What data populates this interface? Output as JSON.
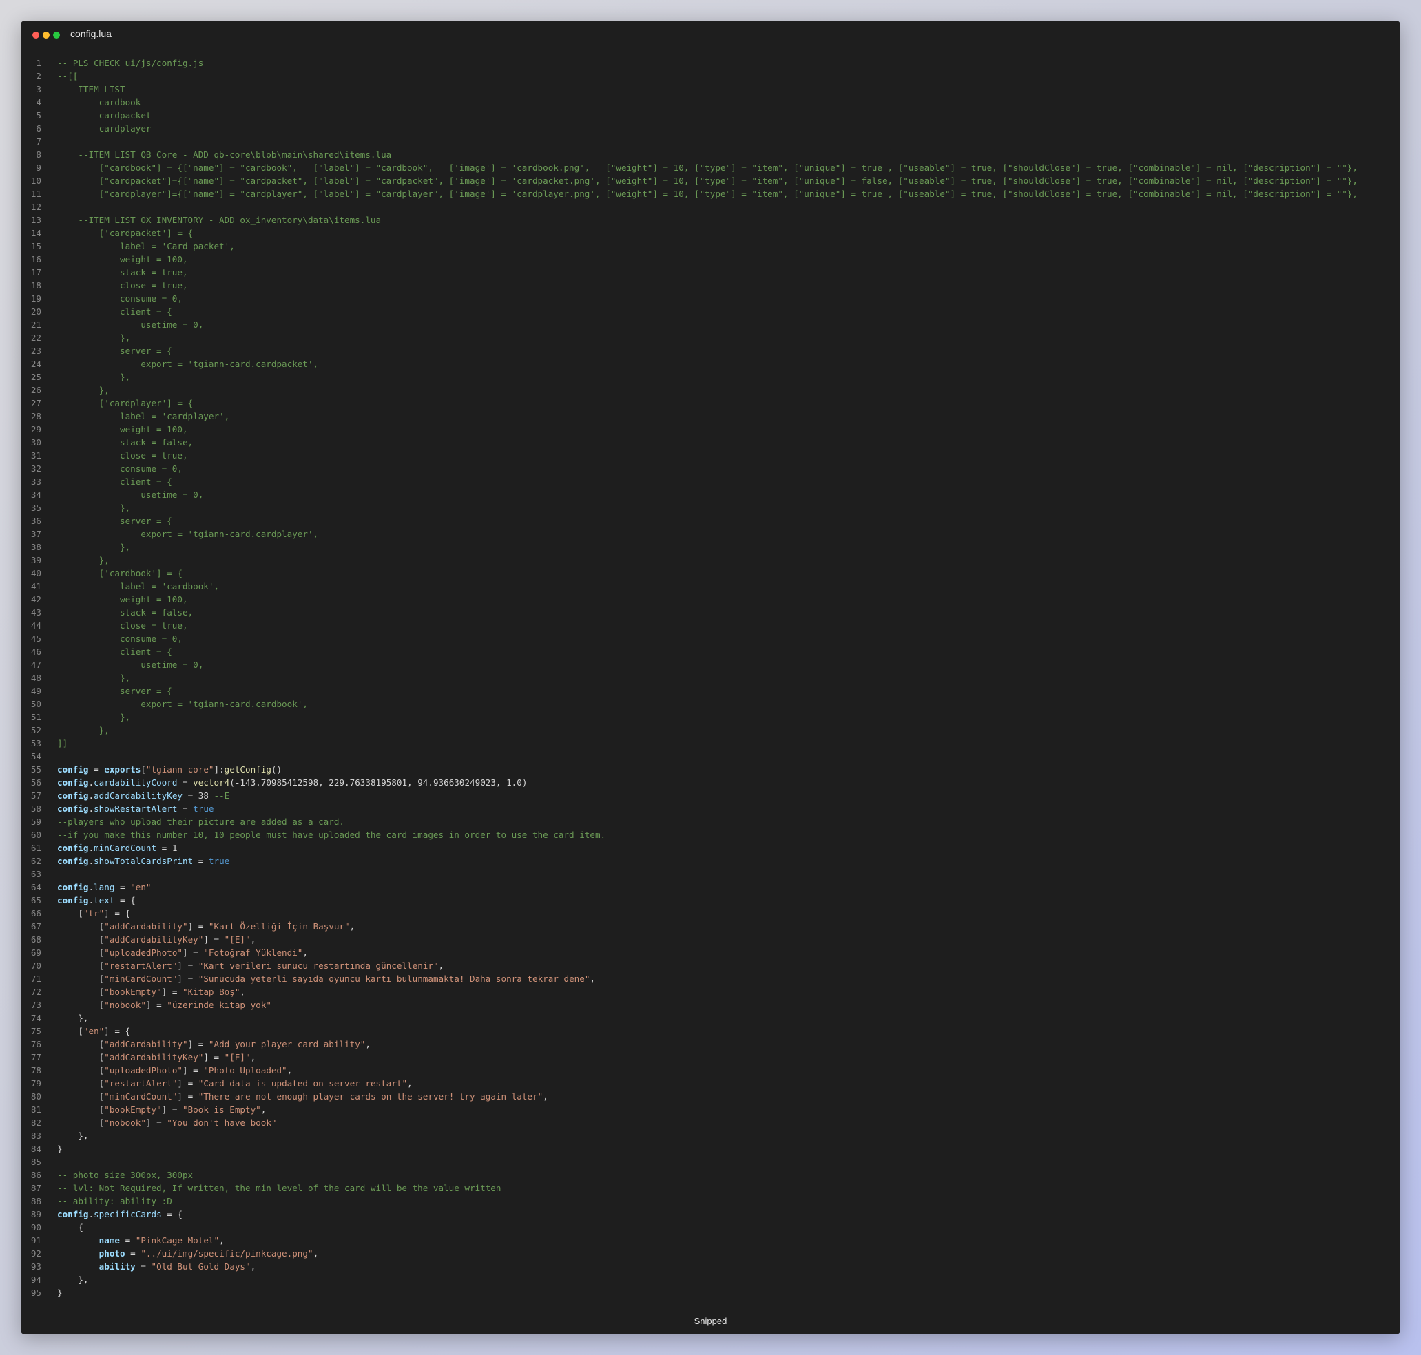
{
  "window": {
    "title": "config.lua",
    "footer": "Snipped"
  },
  "code": [
    {
      "n": "1",
      "t": [
        [
          "cm",
          "-- PLS CHECK ui/js/config.js"
        ]
      ]
    },
    {
      "n": "2",
      "t": [
        [
          "cm",
          "--[["
        ]
      ]
    },
    {
      "n": "3",
      "t": [
        [
          "cm",
          "    ITEM LIST"
        ]
      ]
    },
    {
      "n": "4",
      "t": [
        [
          "cm",
          "        cardbook"
        ]
      ]
    },
    {
      "n": "5",
      "t": [
        [
          "cm",
          "        cardpacket"
        ]
      ]
    },
    {
      "n": "6",
      "t": [
        [
          "cm",
          "        cardplayer"
        ]
      ]
    },
    {
      "n": "7",
      "t": []
    },
    {
      "n": "8",
      "t": [
        [
          "cm",
          "    --ITEM LIST QB Core - ADD qb-core\\blob\\main\\shared\\items.lua"
        ]
      ]
    },
    {
      "n": "9",
      "t": [
        [
          "cm",
          "        [\"cardbook\"] = {[\"name\"] = \"cardbook\",   [\"label\"] = \"cardbook\",   ['image'] = 'cardbook.png',   [\"weight\"] = 10, [\"type\"] = \"item\", [\"unique\"] = true , [\"useable\"] = true, [\"shouldClose\"] = true, [\"combinable\"] = nil, [\"description\"] = \"\"},"
        ]
      ]
    },
    {
      "n": "10",
      "t": [
        [
          "cm",
          "        [\"cardpacket\"]={[\"name\"] = \"cardpacket\", [\"label\"] = \"cardpacket\", ['image'] = 'cardpacket.png', [\"weight\"] = 10, [\"type\"] = \"item\", [\"unique\"] = false, [\"useable\"] = true, [\"shouldClose\"] = true, [\"combinable\"] = nil, [\"description\"] = \"\"},"
        ]
      ]
    },
    {
      "n": "11",
      "t": [
        [
          "cm",
          "        [\"cardplayer\"]={[\"name\"] = \"cardplayer\", [\"label\"] = \"cardplayer\", ['image'] = 'cardplayer.png', [\"weight\"] = 10, [\"type\"] = \"item\", [\"unique\"] = true , [\"useable\"] = true, [\"shouldClose\"] = true, [\"combinable\"] = nil, [\"description\"] = \"\"},"
        ]
      ]
    },
    {
      "n": "12",
      "t": []
    },
    {
      "n": "13",
      "t": [
        [
          "cm",
          "    --ITEM LIST OX INVENTORY - ADD ox_inventory\\data\\items.lua"
        ]
      ]
    },
    {
      "n": "14",
      "t": [
        [
          "cm",
          "        ['cardpacket'] = {"
        ]
      ]
    },
    {
      "n": "15",
      "t": [
        [
          "cm",
          "            label = 'Card packet',"
        ]
      ]
    },
    {
      "n": "16",
      "t": [
        [
          "cm",
          "            weight = 100,"
        ]
      ]
    },
    {
      "n": "17",
      "t": [
        [
          "cm",
          "            stack = true,"
        ]
      ]
    },
    {
      "n": "18",
      "t": [
        [
          "cm",
          "            close = true,"
        ]
      ]
    },
    {
      "n": "19",
      "t": [
        [
          "cm",
          "            consume = 0,"
        ]
      ]
    },
    {
      "n": "20",
      "t": [
        [
          "cm",
          "            client = {"
        ]
      ]
    },
    {
      "n": "21",
      "t": [
        [
          "cm",
          "                usetime = 0,"
        ]
      ]
    },
    {
      "n": "22",
      "t": [
        [
          "cm",
          "            },"
        ]
      ]
    },
    {
      "n": "23",
      "t": [
        [
          "cm",
          "            server = {"
        ]
      ]
    },
    {
      "n": "24",
      "t": [
        [
          "cm",
          "                export = 'tgiann-card.cardpacket',"
        ]
      ]
    },
    {
      "n": "25",
      "t": [
        [
          "cm",
          "            },"
        ]
      ]
    },
    {
      "n": "26",
      "t": [
        [
          "cm",
          "        },"
        ]
      ]
    },
    {
      "n": "27",
      "t": [
        [
          "cm",
          "        ['cardplayer'] = {"
        ]
      ]
    },
    {
      "n": "28",
      "t": [
        [
          "cm",
          "            label = 'cardplayer',"
        ]
      ]
    },
    {
      "n": "29",
      "t": [
        [
          "cm",
          "            weight = 100,"
        ]
      ]
    },
    {
      "n": "30",
      "t": [
        [
          "cm",
          "            stack = false,"
        ]
      ]
    },
    {
      "n": "31",
      "t": [
        [
          "cm",
          "            close = true,"
        ]
      ]
    },
    {
      "n": "32",
      "t": [
        [
          "cm",
          "            consume = 0,"
        ]
      ]
    },
    {
      "n": "33",
      "t": [
        [
          "cm",
          "            client = {"
        ]
      ]
    },
    {
      "n": "34",
      "t": [
        [
          "cm",
          "                usetime = 0,"
        ]
      ]
    },
    {
      "n": "35",
      "t": [
        [
          "cm",
          "            },"
        ]
      ]
    },
    {
      "n": "36",
      "t": [
        [
          "cm",
          "            server = {"
        ]
      ]
    },
    {
      "n": "37",
      "t": [
        [
          "cm",
          "                export = 'tgiann-card.cardplayer',"
        ]
      ]
    },
    {
      "n": "38",
      "t": [
        [
          "cm",
          "            },"
        ]
      ]
    },
    {
      "n": "39",
      "t": [
        [
          "cm",
          "        },"
        ]
      ]
    },
    {
      "n": "40",
      "t": [
        [
          "cm",
          "        ['cardbook'] = {"
        ]
      ]
    },
    {
      "n": "41",
      "t": [
        [
          "cm",
          "            label = 'cardbook',"
        ]
      ]
    },
    {
      "n": "42",
      "t": [
        [
          "cm",
          "            weight = 100,"
        ]
      ]
    },
    {
      "n": "43",
      "t": [
        [
          "cm",
          "            stack = false,"
        ]
      ]
    },
    {
      "n": "44",
      "t": [
        [
          "cm",
          "            close = true,"
        ]
      ]
    },
    {
      "n": "45",
      "t": [
        [
          "cm",
          "            consume = 0,"
        ]
      ]
    },
    {
      "n": "46",
      "t": [
        [
          "cm",
          "            client = {"
        ]
      ]
    },
    {
      "n": "47",
      "t": [
        [
          "cm",
          "                usetime = 0,"
        ]
      ]
    },
    {
      "n": "48",
      "t": [
        [
          "cm",
          "            },"
        ]
      ]
    },
    {
      "n": "49",
      "t": [
        [
          "cm",
          "            server = {"
        ]
      ]
    },
    {
      "n": "50",
      "t": [
        [
          "cm",
          "                export = 'tgiann-card.cardbook',"
        ]
      ]
    },
    {
      "n": "51",
      "t": [
        [
          "cm",
          "            },"
        ]
      ]
    },
    {
      "n": "52",
      "t": [
        [
          "cm",
          "        },"
        ]
      ]
    },
    {
      "n": "53",
      "t": [
        [
          "cm",
          "]]"
        ]
      ]
    },
    {
      "n": "54",
      "t": []
    },
    {
      "n": "55",
      "t": [
        [
          "kb",
          "config"
        ],
        [
          "pu",
          " = "
        ],
        [
          "kb",
          "exports"
        ],
        [
          "pu",
          "["
        ],
        [
          "st",
          "\"tgiann-core\""
        ],
        [
          "pu",
          "]:"
        ],
        [
          "fn",
          "getConfig"
        ],
        [
          "pu",
          "()"
        ]
      ]
    },
    {
      "n": "56",
      "t": [
        [
          "kb",
          "config"
        ],
        [
          "pu",
          "."
        ],
        [
          "ky",
          "cardabilityCoord"
        ],
        [
          "pu",
          " = "
        ],
        [
          "fn",
          "vector4"
        ],
        [
          "pu",
          "(-143.70985412598, 229.76338195801, 94.936630249023, 1.0)"
        ]
      ]
    },
    {
      "n": "57",
      "t": [
        [
          "kb",
          "config"
        ],
        [
          "pu",
          "."
        ],
        [
          "ky",
          "addCardabilityKey"
        ],
        [
          "pu",
          " = 38 "
        ],
        [
          "cm",
          "--E"
        ]
      ]
    },
    {
      "n": "58",
      "t": [
        [
          "kb",
          "config"
        ],
        [
          "pu",
          "."
        ],
        [
          "ky",
          "showRestartAlert"
        ],
        [
          "pu",
          " = "
        ],
        [
          "bo",
          "true"
        ]
      ]
    },
    {
      "n": "59",
      "t": [
        [
          "cm",
          "--players who upload their picture are added as a card."
        ]
      ]
    },
    {
      "n": "60",
      "t": [
        [
          "cm",
          "--if you make this number 10, 10 people must have uploaded the card images in order to use the card item."
        ]
      ]
    },
    {
      "n": "61",
      "t": [
        [
          "kb",
          "config"
        ],
        [
          "pu",
          "."
        ],
        [
          "ky",
          "minCardCount"
        ],
        [
          "pu",
          " = 1"
        ]
      ]
    },
    {
      "n": "62",
      "t": [
        [
          "kb",
          "config"
        ],
        [
          "pu",
          "."
        ],
        [
          "ky",
          "showTotalCardsPrint"
        ],
        [
          "pu",
          " = "
        ],
        [
          "bo",
          "true"
        ]
      ]
    },
    {
      "n": "63",
      "t": []
    },
    {
      "n": "64",
      "t": [
        [
          "kb",
          "config"
        ],
        [
          "pu",
          "."
        ],
        [
          "ky",
          "lang"
        ],
        [
          "pu",
          " = "
        ],
        [
          "st",
          "\"en\""
        ]
      ]
    },
    {
      "n": "65",
      "t": [
        [
          "kb",
          "config"
        ],
        [
          "pu",
          "."
        ],
        [
          "ky",
          "text"
        ],
        [
          "pu",
          " = {"
        ]
      ]
    },
    {
      "n": "66",
      "t": [
        [
          "pu",
          "    ["
        ],
        [
          "st",
          "\"tr\""
        ],
        [
          "pu",
          "] = {"
        ]
      ]
    },
    {
      "n": "67",
      "t": [
        [
          "pu",
          "        ["
        ],
        [
          "st",
          "\"addCardability\""
        ],
        [
          "pu",
          "] = "
        ],
        [
          "st",
          "\"Kart Özelliği İçin Başvur\""
        ],
        [
          "pu",
          ","
        ]
      ]
    },
    {
      "n": "68",
      "t": [
        [
          "pu",
          "        ["
        ],
        [
          "st",
          "\"addCardabilityKey\""
        ],
        [
          "pu",
          "] = "
        ],
        [
          "st",
          "\"[E]\""
        ],
        [
          "pu",
          ","
        ]
      ]
    },
    {
      "n": "69",
      "t": [
        [
          "pu",
          "        ["
        ],
        [
          "st",
          "\"uploadedPhoto\""
        ],
        [
          "pu",
          "] = "
        ],
        [
          "st",
          "\"Fotoğraf Yüklendi\""
        ],
        [
          "pu",
          ","
        ]
      ]
    },
    {
      "n": "70",
      "t": [
        [
          "pu",
          "        ["
        ],
        [
          "st",
          "\"restartAlert\""
        ],
        [
          "pu",
          "] = "
        ],
        [
          "st",
          "\"Kart verileri sunucu restartında güncellenir\""
        ],
        [
          "pu",
          ","
        ]
      ]
    },
    {
      "n": "71",
      "t": [
        [
          "pu",
          "        ["
        ],
        [
          "st",
          "\"minCardCount\""
        ],
        [
          "pu",
          "] = "
        ],
        [
          "st",
          "\"Sunucuda yeterli sayıda oyuncu kartı bulunmamakta! Daha sonra tekrar dene\""
        ],
        [
          "pu",
          ","
        ]
      ]
    },
    {
      "n": "72",
      "t": [
        [
          "pu",
          "        ["
        ],
        [
          "st",
          "\"bookEmpty\""
        ],
        [
          "pu",
          "] = "
        ],
        [
          "st",
          "\"Kitap Boş\""
        ],
        [
          "pu",
          ","
        ]
      ]
    },
    {
      "n": "73",
      "t": [
        [
          "pu",
          "        ["
        ],
        [
          "st",
          "\"nobook\""
        ],
        [
          "pu",
          "] = "
        ],
        [
          "st",
          "\"üzerinde kitap yok\""
        ]
      ]
    },
    {
      "n": "74",
      "t": [
        [
          "pu",
          "    },"
        ]
      ]
    },
    {
      "n": "75",
      "t": [
        [
          "pu",
          "    ["
        ],
        [
          "st",
          "\"en\""
        ],
        [
          "pu",
          "] = {"
        ]
      ]
    },
    {
      "n": "76",
      "t": [
        [
          "pu",
          "        ["
        ],
        [
          "st",
          "\"addCardability\""
        ],
        [
          "pu",
          "] = "
        ],
        [
          "st",
          "\"Add your player card ability\""
        ],
        [
          "pu",
          ","
        ]
      ]
    },
    {
      "n": "77",
      "t": [
        [
          "pu",
          "        ["
        ],
        [
          "st",
          "\"addCardabilityKey\""
        ],
        [
          "pu",
          "] = "
        ],
        [
          "st",
          "\"[E]\""
        ],
        [
          "pu",
          ","
        ]
      ]
    },
    {
      "n": "78",
      "t": [
        [
          "pu",
          "        ["
        ],
        [
          "st",
          "\"uploadedPhoto\""
        ],
        [
          "pu",
          "] = "
        ],
        [
          "st",
          "\"Photo Uploaded\""
        ],
        [
          "pu",
          ","
        ]
      ]
    },
    {
      "n": "79",
      "t": [
        [
          "pu",
          "        ["
        ],
        [
          "st",
          "\"restartAlert\""
        ],
        [
          "pu",
          "] = "
        ],
        [
          "st",
          "\"Card data is updated on server restart\""
        ],
        [
          "pu",
          ","
        ]
      ]
    },
    {
      "n": "80",
      "t": [
        [
          "pu",
          "        ["
        ],
        [
          "st",
          "\"minCardCount\""
        ],
        [
          "pu",
          "] = "
        ],
        [
          "st",
          "\"There are not enough player cards on the server! try again later\""
        ],
        [
          "pu",
          ","
        ]
      ]
    },
    {
      "n": "81",
      "t": [
        [
          "pu",
          "        ["
        ],
        [
          "st",
          "\"bookEmpty\""
        ],
        [
          "pu",
          "] = "
        ],
        [
          "st",
          "\"Book is Empty\""
        ],
        [
          "pu",
          ","
        ]
      ]
    },
    {
      "n": "82",
      "t": [
        [
          "pu",
          "        ["
        ],
        [
          "st",
          "\"nobook\""
        ],
        [
          "pu",
          "] = "
        ],
        [
          "st",
          "\"You don't have book\""
        ]
      ]
    },
    {
      "n": "83",
      "t": [
        [
          "pu",
          "    },"
        ]
      ]
    },
    {
      "n": "84",
      "t": [
        [
          "pu",
          "}"
        ]
      ]
    },
    {
      "n": "85",
      "t": []
    },
    {
      "n": "86",
      "t": [
        [
          "cm",
          "-- photo size 300px, 300px"
        ]
      ]
    },
    {
      "n": "87",
      "t": [
        [
          "cm",
          "-- lvl: Not Required, If written, the min level of the card will be the value written"
        ]
      ]
    },
    {
      "n": "88",
      "t": [
        [
          "cm",
          "-- ability: ability :D"
        ]
      ]
    },
    {
      "n": "89",
      "t": [
        [
          "kb",
          "config"
        ],
        [
          "pu",
          "."
        ],
        [
          "ky",
          "specificCards"
        ],
        [
          "pu",
          " = {"
        ]
      ]
    },
    {
      "n": "90",
      "t": [
        [
          "pu",
          "    {"
        ]
      ]
    },
    {
      "n": "91",
      "t": [
        [
          "pu",
          "        "
        ],
        [
          "kb",
          "name"
        ],
        [
          "pu",
          " = "
        ],
        [
          "st",
          "\"PinkCage Motel\""
        ],
        [
          "pu",
          ","
        ]
      ]
    },
    {
      "n": "92",
      "t": [
        [
          "pu",
          "        "
        ],
        [
          "kb",
          "photo"
        ],
        [
          "pu",
          " = "
        ],
        [
          "st",
          "\"../ui/img/specific/pinkcage.png\""
        ],
        [
          "pu",
          ","
        ]
      ]
    },
    {
      "n": "93",
      "t": [
        [
          "pu",
          "        "
        ],
        [
          "kb",
          "ability"
        ],
        [
          "pu",
          " = "
        ],
        [
          "st",
          "\"Old But Gold Days\""
        ],
        [
          "pu",
          ","
        ]
      ]
    },
    {
      "n": "94",
      "t": [
        [
          "pu",
          "    },"
        ]
      ]
    },
    {
      "n": "95",
      "t": [
        [
          "pu",
          "}"
        ]
      ]
    }
  ]
}
